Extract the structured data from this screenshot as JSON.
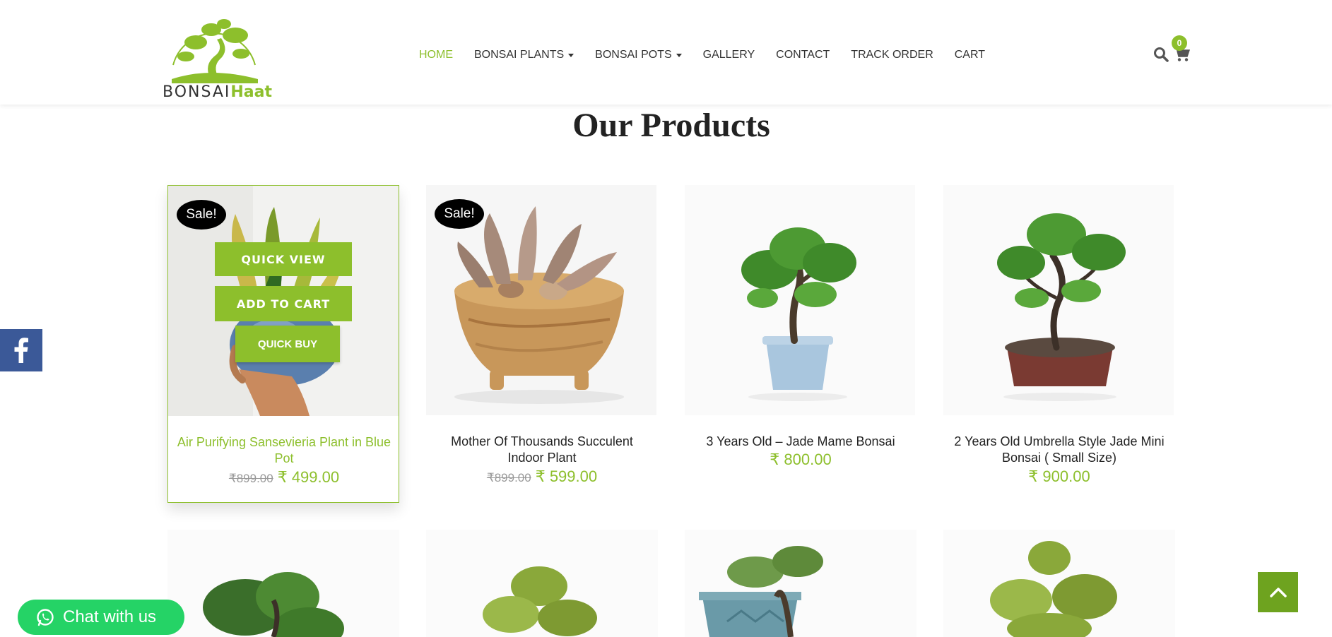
{
  "brand": {
    "logo_text_a": "BONSAI",
    "logo_text_b": "Haat",
    "accent": "#8dbf2c"
  },
  "nav": {
    "items": [
      {
        "label": "HOME",
        "active": true,
        "dropdown": false
      },
      {
        "label": "BONSAI PLANTS",
        "active": false,
        "dropdown": true
      },
      {
        "label": "BONSAI POTS",
        "active": false,
        "dropdown": true
      },
      {
        "label": "GALLERY",
        "active": false,
        "dropdown": false
      },
      {
        "label": "CONTACT",
        "active": false,
        "dropdown": false
      },
      {
        "label": "TRACK ORDER",
        "active": false,
        "dropdown": false
      },
      {
        "label": "CART",
        "active": false,
        "dropdown": false
      }
    ],
    "cart_count": "0",
    "icons": [
      "search-icon",
      "cart-icon"
    ]
  },
  "section": {
    "title": "Our Products"
  },
  "products": [
    {
      "title": "Air Purifying Sansevieria Plant in Blue Pot",
      "sale_badge": "Sale!",
      "old_price": "₹899.00",
      "new_price": "₹ 499.00",
      "buttons": {
        "quick_view": "QUICK VIEW",
        "add_to_cart": "ADD TO CART",
        "quick_buy": "QUICK BUY"
      }
    },
    {
      "title": "Mother Of Thousands Succulent Indoor Plant",
      "sale_badge": "Sale!",
      "old_price": "₹899.00",
      "new_price": "₹ 599.00"
    },
    {
      "title": "3 Years Old – Jade Mame Bonsai",
      "new_price": "₹ 800.00"
    },
    {
      "title": "2 Years Old Umbrella Style Jade Mini Bonsai ( Small Size)",
      "new_price": "₹ 900.00"
    }
  ],
  "floating": {
    "chat_label": "Chat with us",
    "facebook_icon": "facebook-icon",
    "scroll_top_icon": "chevron-up-icon",
    "chat_color": "#25d366",
    "facebook_color": "#3b5998"
  }
}
